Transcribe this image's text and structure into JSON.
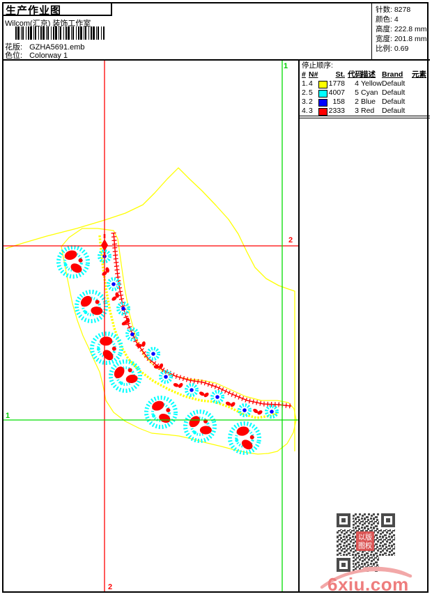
{
  "header": {
    "title": "生产作业图",
    "company": "Wilcom(汇京) 装饰工作室",
    "pattern_label": "花版:",
    "pattern_value": "GZHA5691.emb",
    "colorway_label": "色位:",
    "colorway_value": "Colorway 1"
  },
  "info": {
    "rows": [
      {
        "label": "针数:",
        "value": "8278"
      },
      {
        "label": "颜色:",
        "value": "4"
      },
      {
        "label": "高度:",
        "value": "222.8 mm"
      },
      {
        "label": "宽度:",
        "value": "201.8 mm"
      },
      {
        "label": "比例:",
        "value": "0.69"
      }
    ]
  },
  "stop_sequence": {
    "title": "停止顺序:",
    "headers": {
      "seq": "#",
      "needle": "N#",
      "stitches": "St.",
      "code": "代码",
      "description": "描述",
      "brand": "Brand",
      "element": "元素"
    },
    "rows": [
      {
        "seq": "1.",
        "needle": "4",
        "color": "#FFFF00",
        "stitches": "1778",
        "code": "4",
        "description": "Yellow",
        "brand": "Default"
      },
      {
        "seq": "2.",
        "needle": "5",
        "color": "#00FFFF",
        "stitches": "4007",
        "code": "5",
        "description": "Cyan",
        "brand": "Default"
      },
      {
        "seq": "3.",
        "needle": "2",
        "color": "#0000FF",
        "stitches": "158",
        "code": "2",
        "description": "Blue",
        "brand": "Default"
      },
      {
        "seq": "4.",
        "needle": "3",
        "color": "#FF0000",
        "stitches": "2333",
        "code": "3",
        "description": "Red",
        "brand": "Default"
      }
    ]
  },
  "grid_markers": {
    "green_vertical_top": "1",
    "red_horizontal_right": "2",
    "green_horizontal_left": "1",
    "red_vertical_bottom": "2"
  },
  "design_colors": {
    "thread_yellow": "#FFFF00",
    "thread_cyan": "#00FFFF",
    "thread_blue": "#0000FF",
    "thread_red": "#FF0000",
    "grid_green": "#00DD00",
    "grid_red": "#FF0000"
  },
  "watermark": {
    "site": "6xiu.com",
    "seal_line1": "以版",
    "seal_line2": "图权"
  }
}
